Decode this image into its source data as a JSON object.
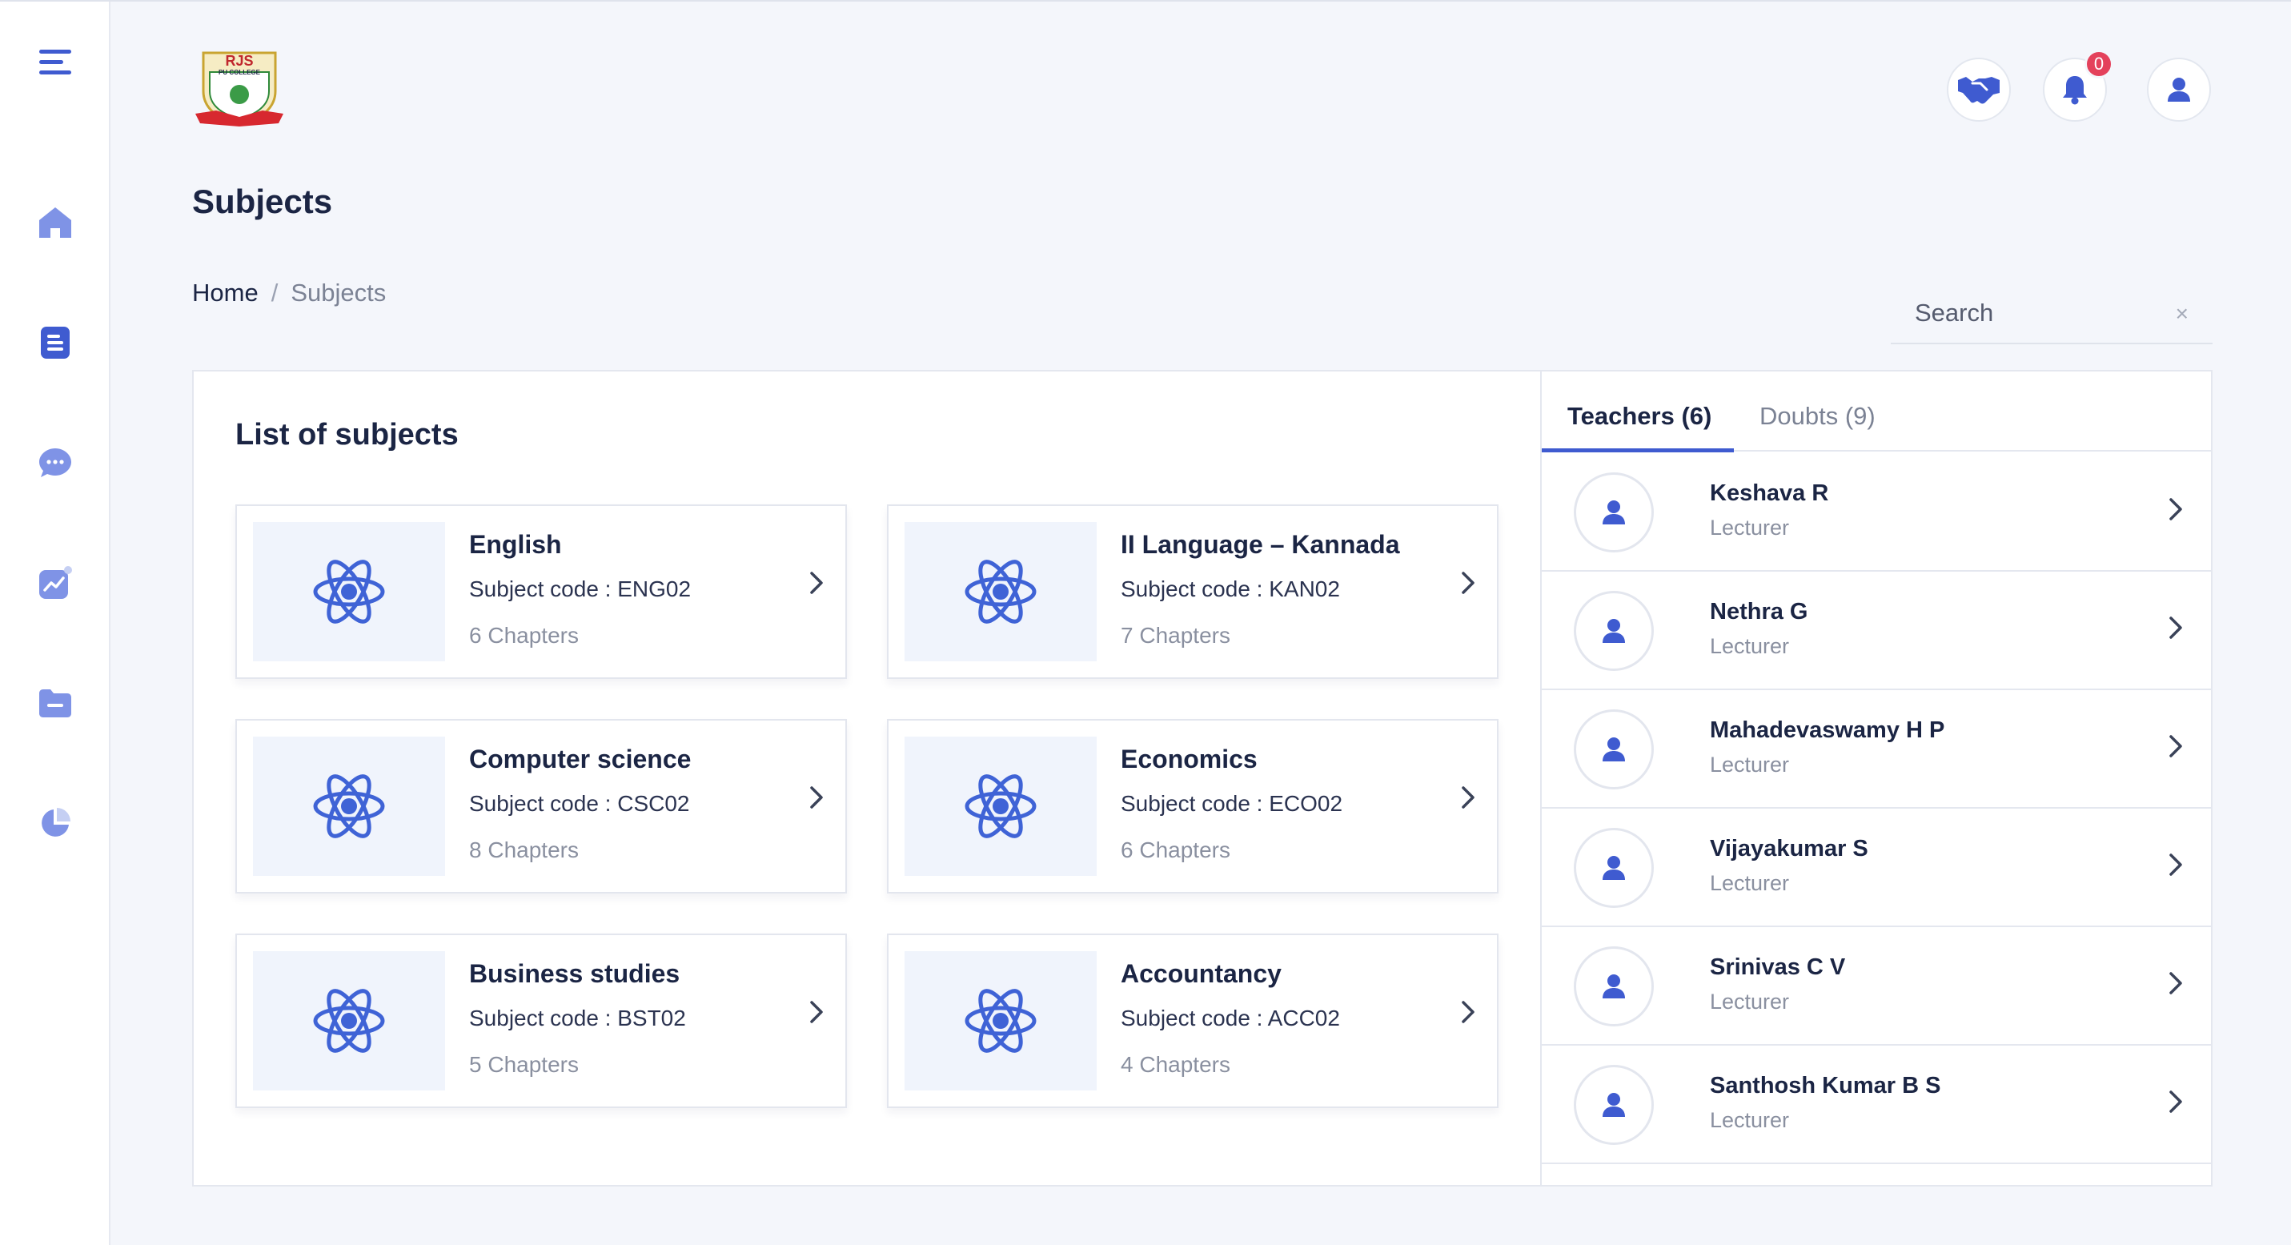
{
  "colors": {
    "accent": "#3f5bd0",
    "icon_blue": "#3f63d6",
    "icon_light": "#7f93e6",
    "badge": "#e4415b",
    "thumb_bg": "#f0f4fc"
  },
  "sidebar": {
    "items": [
      {
        "icon": "menu-icon"
      },
      {
        "icon": "home-icon"
      },
      {
        "icon": "document-icon"
      },
      {
        "icon": "chat-icon"
      },
      {
        "icon": "analytics-icon"
      },
      {
        "icon": "folder-icon"
      },
      {
        "icon": "pie-chart-icon"
      }
    ]
  },
  "header": {
    "logo_text": "RJS",
    "logo_subtext": "PU COLLEGE",
    "icons": [
      "handshake-icon",
      "bell-icon",
      "user-icon"
    ],
    "notification_count": "0"
  },
  "page": {
    "title": "Subjects",
    "breadcrumb": {
      "home": "Home",
      "separator": "/",
      "current": "Subjects"
    }
  },
  "search": {
    "placeholder": "Search",
    "clear": "×"
  },
  "subjects": {
    "title": "List of subjects",
    "items": [
      {
        "name": "English",
        "code": "Subject code : ENG02",
        "chapters": "6 Chapters"
      },
      {
        "name": "II Language – Kannada",
        "code": "Subject code : KAN02",
        "chapters": "7 Chapters"
      },
      {
        "name": "Computer science",
        "code": "Subject code : CSC02",
        "chapters": "8 Chapters"
      },
      {
        "name": "Economics",
        "code": "Subject code : ECO02",
        "chapters": "6 Chapters"
      },
      {
        "name": "Business studies",
        "code": "Subject code : BST02",
        "chapters": "5 Chapters"
      },
      {
        "name": "Accountancy",
        "code": "Subject code : ACC02",
        "chapters": "4 Chapters"
      }
    ]
  },
  "tabs": [
    {
      "label": "Teachers (6)",
      "active": true
    },
    {
      "label": "Doubts (9)",
      "active": false
    }
  ],
  "teachers": [
    {
      "name": "Keshava R",
      "role": "Lecturer"
    },
    {
      "name": "Nethra G",
      "role": "Lecturer"
    },
    {
      "name": "Mahadevaswamy H P",
      "role": "Lecturer"
    },
    {
      "name": "Vijayakumar S",
      "role": "Lecturer"
    },
    {
      "name": "Srinivas C V",
      "role": "Lecturer"
    },
    {
      "name": "Santhosh Kumar B S",
      "role": "Lecturer"
    }
  ]
}
